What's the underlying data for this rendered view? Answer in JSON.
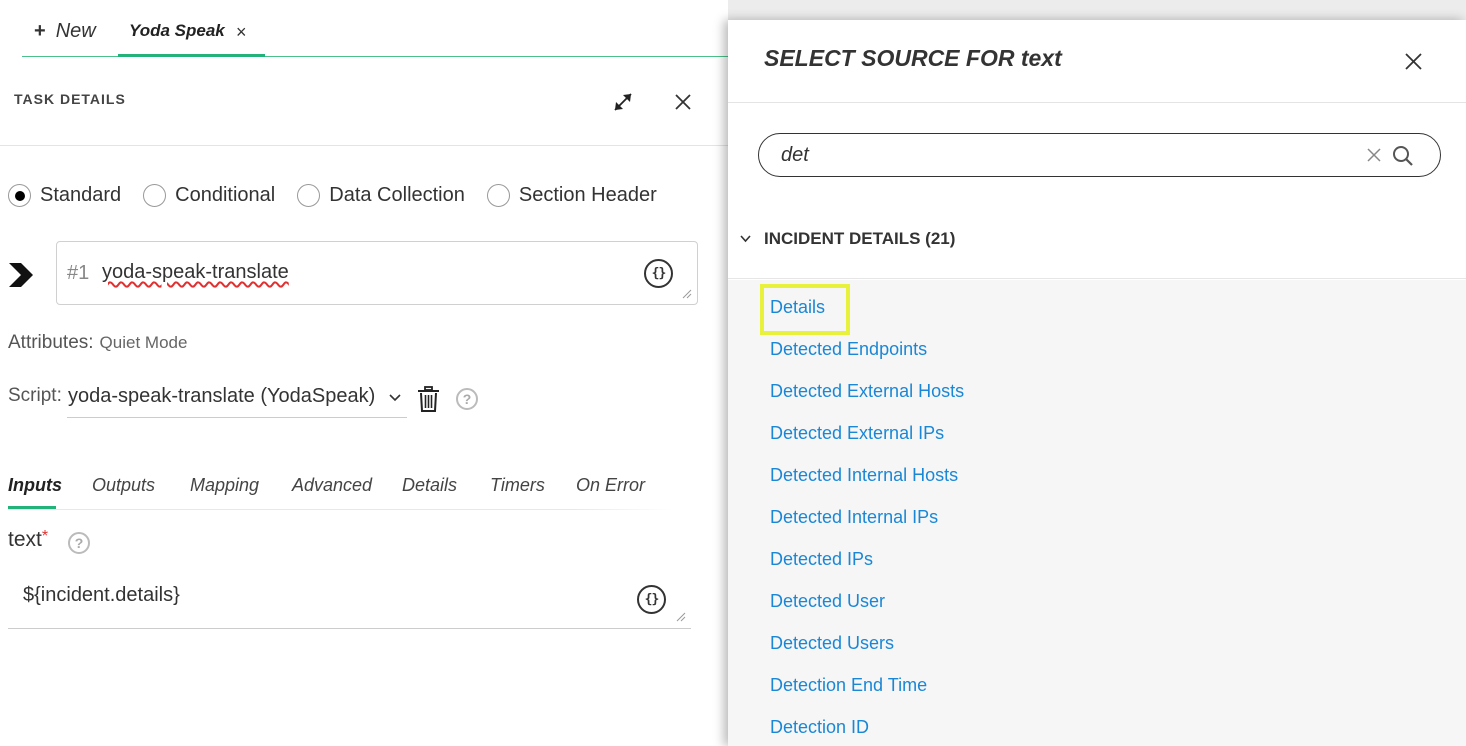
{
  "tabs": {
    "new_label": "New",
    "active_label": "Yoda Speak",
    "close_glyph": "×"
  },
  "task_details": {
    "header": "TASK DETAILS",
    "radio_options": [
      {
        "label": "Standard",
        "checked": true
      },
      {
        "label": "Conditional",
        "checked": false
      },
      {
        "label": "Data Collection",
        "checked": false
      },
      {
        "label": "Section Header",
        "checked": false
      }
    ],
    "task_number": "#1",
    "task_name": "yoda-speak-translate",
    "attributes_label": "Attributes:",
    "attributes_value": "Quiet Mode",
    "script_label": "Script:",
    "script_value": "yoda-speak-translate (YodaSpeak)",
    "subtabs": [
      "Inputs",
      "Outputs",
      "Mapping",
      "Advanced",
      "Details",
      "Timers",
      "On Error"
    ],
    "input_label": "text",
    "input_required": "*",
    "input_value": "${incident.details}",
    "code_glyph": "{}",
    "help_glyph": "?"
  },
  "source_panel": {
    "title": "SELECT SOURCE FOR text",
    "search_value": "det",
    "group_title": "INCIDENT DETAILS (21)",
    "items": [
      "Details",
      "Detected Endpoints",
      "Detected External Hosts",
      "Detected External IPs",
      "Detected Internal Hosts",
      "Detected Internal IPs",
      "Detected IPs",
      "Detected User",
      "Detected Users",
      "Detection End Time",
      "Detection ID"
    ]
  },
  "colors": {
    "accent_green": "#23b37a",
    "link_blue": "#1a87d6",
    "highlight_yellow": "#e8f23c",
    "required_red": "#d33333"
  }
}
